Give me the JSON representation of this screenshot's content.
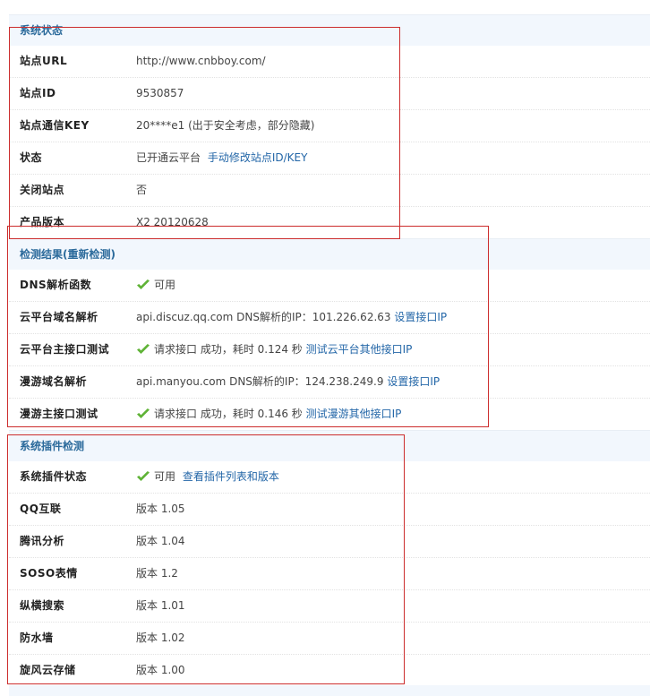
{
  "section1": {
    "title": "系统状态",
    "rows": [
      {
        "label": "站点URL",
        "value": "http://www.cnbboy.com/"
      },
      {
        "label": "站点ID",
        "value": "9530857"
      },
      {
        "label": "站点通信KEY",
        "value": "20****e1 (出于安全考虑，部分隐藏)"
      },
      {
        "label": "状态",
        "value": "已开通云平台",
        "link": "手动修改站点ID/KEY"
      },
      {
        "label": "关闭站点",
        "value": "否"
      },
      {
        "label": "产品版本",
        "value": "X2 20120628"
      }
    ]
  },
  "section2": {
    "title": "检测结果",
    "title_link": "(重新检测)",
    "rows": [
      {
        "label": "DNS解析函数",
        "value": "可用"
      },
      {
        "label": "云平台域名解析",
        "value": "api.discuz.qq.com DNS解析的IP：101.226.62.63",
        "link": "设置接口IP"
      },
      {
        "label": "云平台主接口测试",
        "value": "请求接口 成功，耗时 0.124 秒",
        "link": "测试云平台其他接口IP"
      },
      {
        "label": "漫游域名解析",
        "value": "api.manyou.com DNS解析的IP：124.238.249.9",
        "link": "设置接口IP"
      },
      {
        "label": "漫游主接口测试",
        "value": "请求接口 成功，耗时 0.146 秒",
        "link": "测试漫游其他接口IP"
      }
    ]
  },
  "section3": {
    "title": "系统插件检测",
    "rows": [
      {
        "label": "系统插件状态",
        "value": "可用",
        "link": "查看插件列表和版本"
      },
      {
        "label": "QQ互联",
        "value": "版本 1.05"
      },
      {
        "label": "腾讯分析",
        "value": "版本 1.04"
      },
      {
        "label": "SOSO表情",
        "value": "版本 1.2"
      },
      {
        "label": "纵横搜索",
        "value": "版本 1.01"
      },
      {
        "label": "防水墙",
        "value": "版本 1.02"
      },
      {
        "label": "旋风云存储",
        "value": "版本 1.00"
      }
    ]
  },
  "icons": {
    "check": "check-icon"
  },
  "colors": {
    "header_bg": "#f2f7fd",
    "header_text": "#2b6a9b",
    "link": "#2467a8",
    "check": "#5fb336",
    "highlight": "#cc2d2d"
  }
}
